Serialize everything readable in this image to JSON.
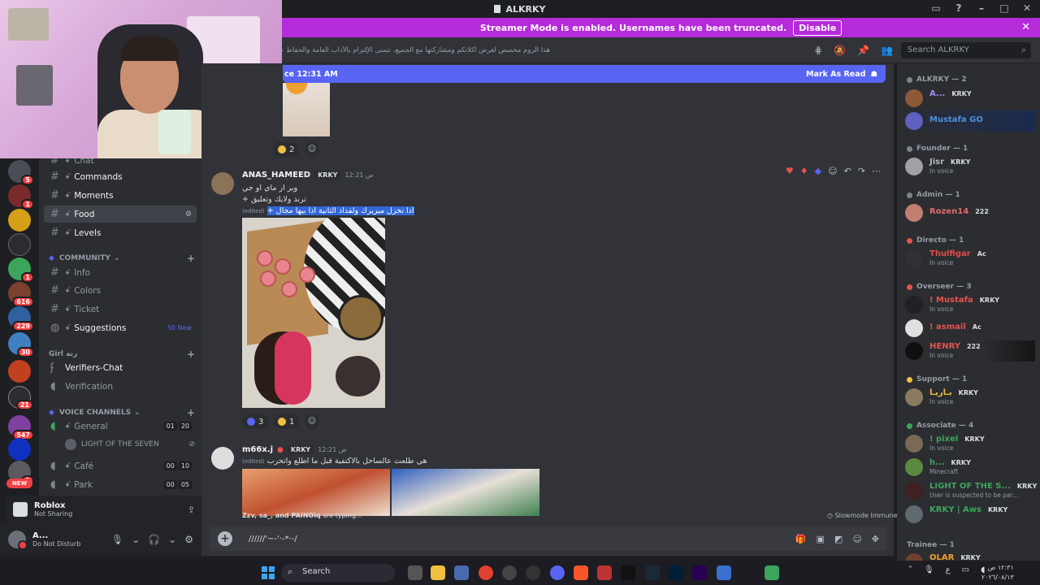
{
  "window": {
    "title": "ALKRKY"
  },
  "banner": {
    "text": "Streamer Mode is enabled. Usernames have been truncated.",
    "disable_label": "Disable"
  },
  "topbar": {
    "topic": "هذا الروم مخصص لعرض أكلاتكم ومشاركتها مع الجميع، نتمنى الإلتزام بالآداب العامة والحفاظ على جودة المحتوى.",
    "search_placeholder": "Search ALKRKY"
  },
  "servers": {
    "badges": [
      "5",
      "1",
      "616",
      "229",
      "30",
      "21",
      "547",
      "1"
    ],
    "new_label": "NEW"
  },
  "sidebar": {
    "channels_top": [
      {
        "name": "Chat",
        "prefix": "ꗃ"
      },
      {
        "name": "Commands",
        "prefix": "ꗃ"
      },
      {
        "name": "Moments",
        "prefix": "ꗃ"
      },
      {
        "name": "Food",
        "prefix": "ꗃ"
      },
      {
        "name": "Levels",
        "prefix": "ꗃ"
      }
    ],
    "community_label": "COMMUNITY",
    "community_channels": [
      {
        "name": "Info",
        "prefix": "ꗃ"
      },
      {
        "name": "Colors",
        "prefix": "ꗃ"
      },
      {
        "name": "Ticket",
        "prefix": "ꗃ"
      },
      {
        "name": "Suggestions",
        "prefix": "ꗃ",
        "badge": "50 New"
      }
    ],
    "girl_label": "Girl رنة",
    "girl_channels": [
      {
        "name": "Verifiers-Chat",
        "prefix": "ꗃ"
      },
      {
        "name": "Verification",
        "prefix": "ꗃ"
      }
    ],
    "voice_label": "VOICE CHANNELS",
    "voice_channels": [
      {
        "name": "General",
        "prefix": "ꗃ",
        "count": "01",
        "limit": "20"
      },
      {
        "name": "Café",
        "prefix": "ꗃ",
        "count": "00",
        "limit": "10"
      },
      {
        "name": "Park",
        "prefix": "ꗃ",
        "count": "00",
        "limit": "05"
      }
    ],
    "voice_user": "LIGHT OF THE SEVEN"
  },
  "activity": {
    "title": "Roblox",
    "subtitle": "Not Sharing"
  },
  "user": {
    "name": "A...",
    "status": "Do Not Disturb"
  },
  "chat": {
    "new_since": "ce 12:31 AM",
    "mark_read": "Mark As Read",
    "top_reaction_count": "2",
    "messages": [
      {
        "author": "ANAS_HAMEED",
        "tag": "KRKY",
        "time": "ص 12:21",
        "lines": [
          "وير از ماي او جي",
          "+ ترند ولايك وتعليق",
          "+ اذا تخزل ميزيرك ولقذاذ الثانية اذا بيها مجال وهاذهي"
        ],
        "selected": "+ اذا تخزل ميزيرك ولقذاذ الثانية اذا بيها مجال",
        "edited": "(edited)",
        "reactions": [
          "3",
          "1"
        ]
      },
      {
        "author": "m66x.j",
        "tag": "KRKY",
        "time": "ص 12:21",
        "lines": [
          "هي طلعت عالساحل بالاكتفية قبل ما اطلع واتحرب"
        ],
        "edited": "(edited)"
      }
    ],
    "typing": {
      "names": "Zzv, sa_, and PAINOiq",
      "suffix": "are typing..."
    },
    "slowmode": "Slowmode Immune",
    "composer_value": "//////'~-'·-*·-/"
  },
  "members": {
    "roles": [
      {
        "label": "ALKRKY — 2"
      },
      {
        "label": "Founder — 1"
      },
      {
        "label": "Admin — 1"
      },
      {
        "label": "Directo — 1"
      },
      {
        "label": "Overseer — 3"
      },
      {
        "label": "Support — 1"
      },
      {
        "label": "Associate — 4"
      },
      {
        "label": "Trainee — 1"
      }
    ],
    "list": [
      {
        "name": "A...",
        "tag": "KRKY",
        "status": "",
        "color": "#a78bfa"
      },
      {
        "name": "Mustafa GO",
        "tag": "",
        "status": "",
        "color": "#4a90e2"
      },
      {
        "name": "Jisr",
        "tag": "KRKY",
        "status": "In voice",
        "color": "#b5bac1"
      },
      {
        "name": "Rozen14",
        "tag": "222",
        "status": "",
        "color": "#e06a6a"
      },
      {
        "name": "Thulfigar",
        "tag": "Ac",
        "status": "In voice",
        "color": "#e54b4b"
      },
      {
        "name": "! Mustafa",
        "tag": "KRKY",
        "status": "In voice",
        "color": "#e5534b"
      },
      {
        "name": "! asmail",
        "tag": "Ac",
        "status": "",
        "color": "#e5534b"
      },
      {
        "name": "HENRY",
        "tag": "222",
        "status": "In voice",
        "color": "#e5534b"
      },
      {
        "name": "بـاريـا",
        "tag": "KRKY",
        "status": "In voice",
        "color": "#f0c040"
      },
      {
        "name": "! pixel",
        "tag": "KRKY",
        "status": "In voice",
        "color": "#3ba55c"
      },
      {
        "name": "h...",
        "tag": "KRKY",
        "status": "Minecraft",
        "color": "#3ba55c"
      },
      {
        "name": "LIGHT OF THE S...",
        "tag": "KRKY",
        "status": "User is suspected to be par...",
        "color": "#3ba55c"
      },
      {
        "name": "KRKY | Aws",
        "tag": "KRKY",
        "status": "",
        "color": "#3ba55c"
      },
      {
        "name": "OLAR",
        "tag": "KRKY",
        "status": "",
        "color": "#f0a030"
      }
    ]
  },
  "taskbar": {
    "search_label": "Search",
    "clock_time": "١٢:٣١ ص",
    "clock_date": "٢٠٢٦/٠٨/١٣",
    "lang": "ع"
  }
}
